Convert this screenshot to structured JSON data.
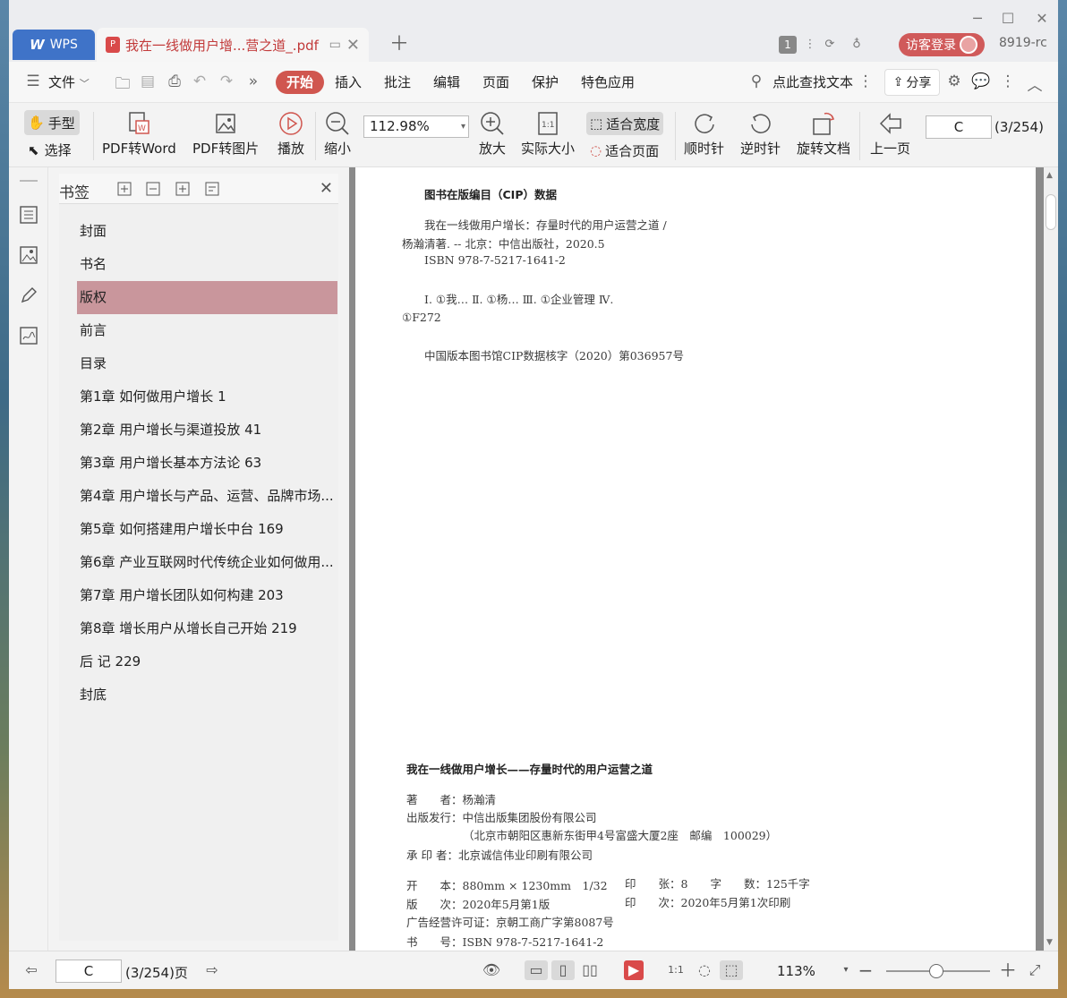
{
  "titlebar": {
    "wps_label": "WPS",
    "doc_tab_title": "我在一线做用户增...营之道_.pdf",
    "badge": "1",
    "login_label": "访客登录",
    "user_id": "8919-rc"
  },
  "menubar": {
    "file_label": "文件",
    "items": [
      "开始",
      "插入",
      "批注",
      "编辑",
      "页面",
      "保护",
      "特色应用"
    ],
    "search_label": "点此查找文本",
    "share_label": "分享"
  },
  "toolbar": {
    "hand_label": "手型",
    "select_label": "选择",
    "pdf_to_word": "PDF转Word",
    "pdf_to_image": "PDF转图片",
    "play": "播放",
    "zoom_out": "缩小",
    "zoom_value": "112.98%",
    "zoom_in": "放大",
    "actual_size": "实际大小",
    "fit_width": "适合宽度",
    "fit_page": "适合页面",
    "clockwise": "顺时针",
    "counterclockwise": "逆时针",
    "rotate_doc": "旋转文档",
    "prev_page": "上一页",
    "page_input": "C",
    "page_count": "(3/254)"
  },
  "bookmarks": {
    "title": "书签",
    "active_index": 2,
    "items": [
      {
        "label": "封面",
        "expandable": false
      },
      {
        "label": "书名",
        "expandable": false
      },
      {
        "label": "版权",
        "expandable": false
      },
      {
        "label": "前言",
        "expandable": false
      },
      {
        "label": "目录",
        "expandable": false
      },
      {
        "label": "第1章 如何做用户增长   1",
        "expandable": true
      },
      {
        "label": "第2章 用户增长与渠道投放   41",
        "expandable": true
      },
      {
        "label": "第3章 用户增长基本方法论   63",
        "expandable": true
      },
      {
        "label": "第4章 用户增长与产品、运营、品牌市场...",
        "expandable": true
      },
      {
        "label": "第5章 如何搭建用户增长中台   169",
        "expandable": true
      },
      {
        "label": "第6章 产业互联网时代传统企业如何做用...",
        "expandable": true
      },
      {
        "label": "第7章 用户增长团队如何构建   203",
        "expandable": true
      },
      {
        "label": "第8章 增长用户从增长自己开始   219",
        "expandable": false
      },
      {
        "label": "后 记   229",
        "expandable": false
      },
      {
        "label": "封底",
        "expandable": false
      }
    ]
  },
  "page": {
    "cip_title": "图书在版编目（CIP）数据",
    "cip_line1": "我在一线做用户增长：存量时代的用户运营之道 /",
    "cip_line2": "杨瀚清著. -- 北京：中信出版社，2020.5",
    "cip_isbn": "ISBN 978-7-5217-1641-2",
    "cip_class1": "Ⅰ. ①我… Ⅱ. ①杨… Ⅲ. ①企业管理 Ⅳ.",
    "cip_class2": "①F272",
    "cip_note": "中国版本图书馆CIP数据核字（2020）第036957号",
    "book_title": "我在一线做用户增长——存量时代的用户运营之道",
    "author": "著　　者：杨瀚清",
    "publisher": "出版发行：中信出版集团股份有限公司",
    "address": "（北京市朝阳区惠新东街甲4号富盛大厦2座　邮编　100029）",
    "printer": "承 印 者：北京诚信伟业印刷有限公司",
    "format": "开　　本：880mm × 1230mm　1/32",
    "sheets": "印　　张：8　　字　　数：125千字",
    "edition": "版　　次：2020年5月第1版",
    "printing": "印　　次：2020年5月第1次印刷",
    "ad_license": "广告经营许可证：京朝工商广字第8087号",
    "isbn_full": "书　　号：ISBN 978-7-5217-1641-2"
  },
  "statusbar": {
    "page_input": "C",
    "page_count": "(3/254)页",
    "zoom": "113%"
  },
  "colors": {
    "accent": "#d0564f",
    "wps_blue": "#3f73c8",
    "bookmark_active": "#c9969c"
  }
}
